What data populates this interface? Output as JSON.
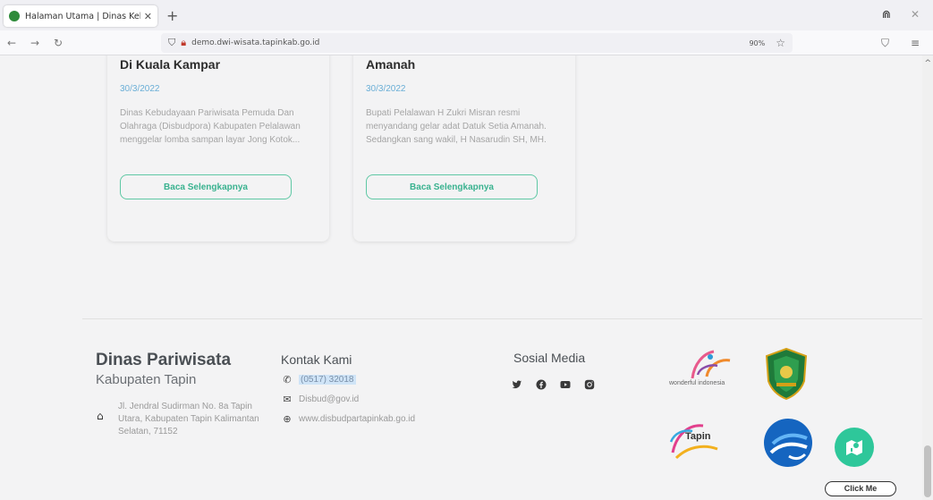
{
  "browser": {
    "tab_title": "Halaman Utama | Dinas Kebud...",
    "tab_close": "✕",
    "new_tab": "+",
    "url": "demo.dwi-wisata.tapinkab.go.id",
    "zoom": "90%"
  },
  "cards": [
    {
      "title": "Di Kuala Kampar",
      "date": "30/3/2022",
      "description": "Dinas Kebudayaan Pariwisata Pemuda Dan Olahraga (Disbudpora) Kabupaten Pelalawan menggelar lomba sampan layar Jong Kotok...",
      "button": "Baca Selengkapnya"
    },
    {
      "title": "Amanah",
      "date": "30/3/2022",
      "description": "Bupati Pelalawan H Zukri Misran resmi menyandang gelar adat Datuk Setia Amanah. Sedangkan sang wakil, H Nasarudin SH, MH.",
      "button": "Baca Selengkapnya"
    }
  ],
  "footer": {
    "org_title": "Dinas Pariwisata",
    "org_subtitle": "Kabupaten Tapin",
    "address": "Jl. Jendral Sudirman No. 8a Tapin Utara, Kabupaten Tapin Kalimantan Selatan, 71152",
    "contact_title": "Kontak Kami",
    "phone": "(0517) 32018",
    "email": "Disbud@gov.id",
    "website": "www.disbudpartapinkab.go.id",
    "social_title": "Sosial Media",
    "social_icons": [
      "twitter-icon",
      "facebook-icon",
      "youtube-icon",
      "instagram-icon"
    ],
    "logo_wonderful_text": "wonderful indonesia",
    "logo_tapin_text": "Tapin",
    "click_me": "Click Me"
  }
}
